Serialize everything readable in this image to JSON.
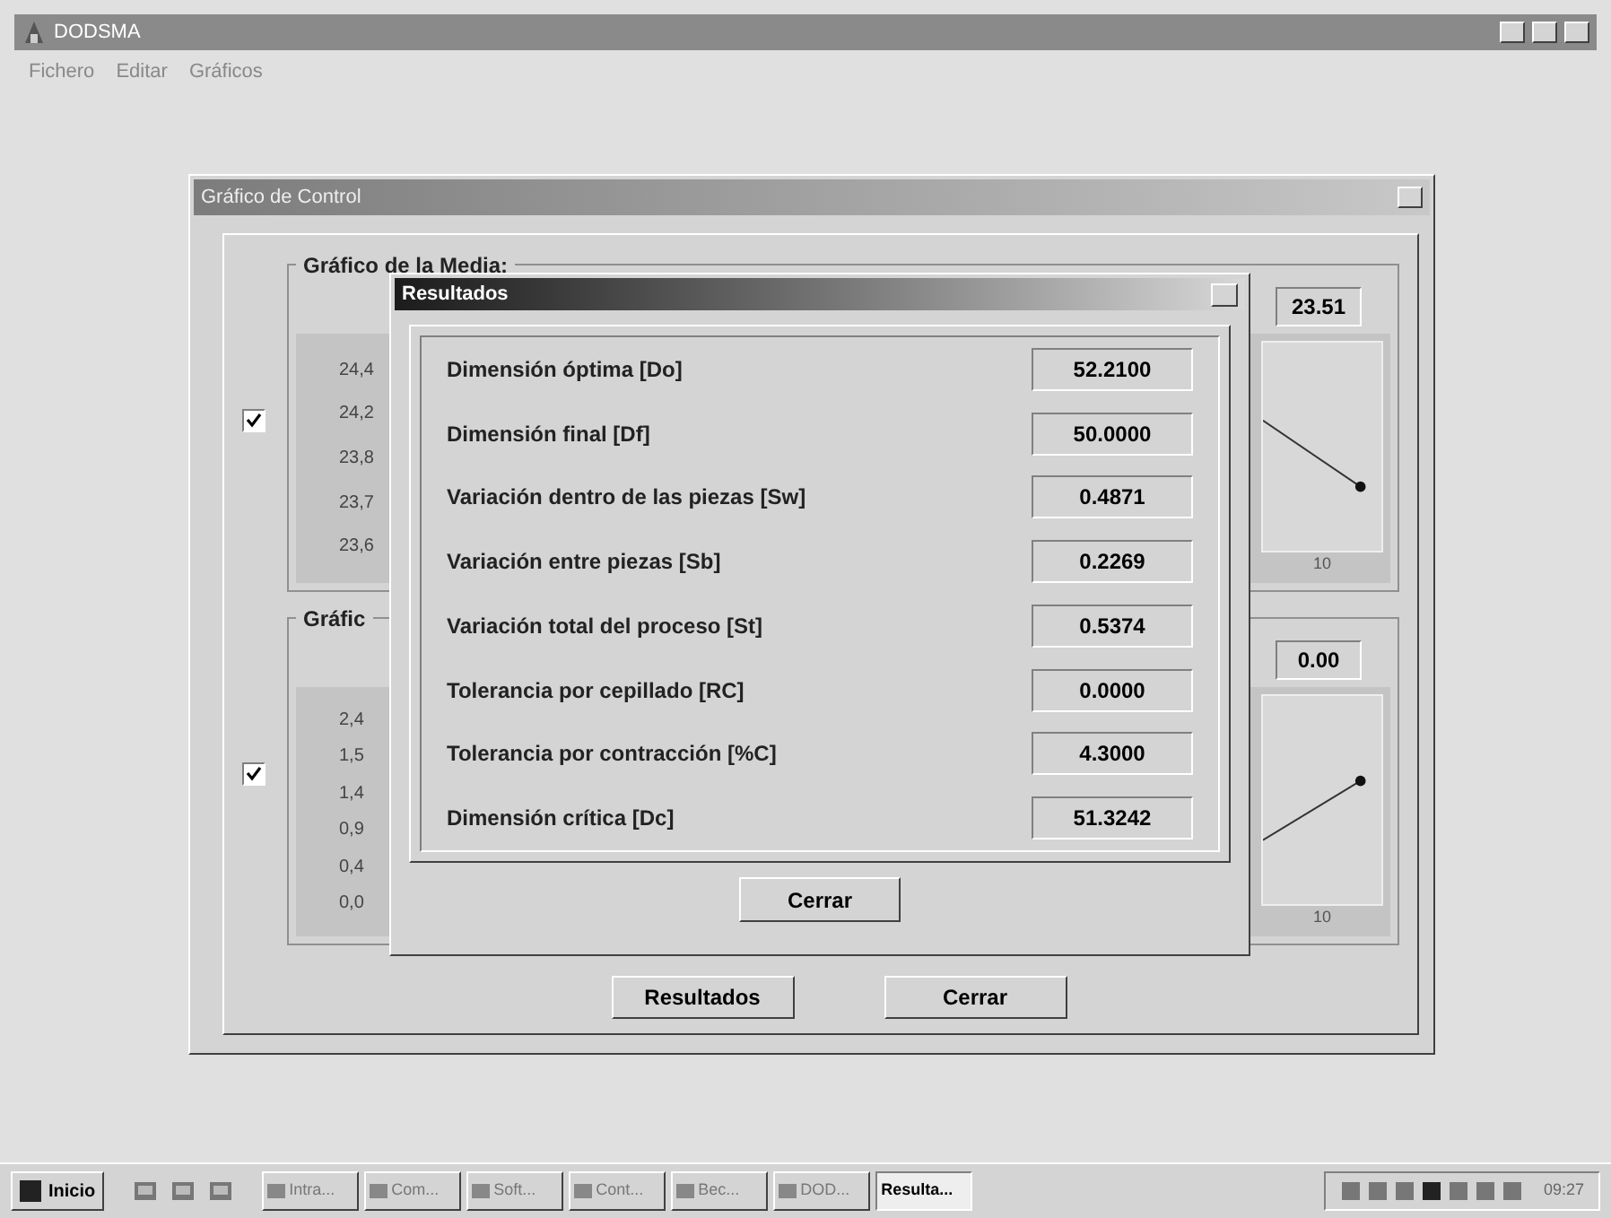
{
  "app_window": {
    "title": "DODSMA",
    "menu": [
      "Fichero",
      "Editar",
      "Gráficos"
    ]
  },
  "control_window": {
    "title": "Gráfico de Control",
    "groups": [
      {
        "title": "Gráfico de la Media:",
        "checked": true,
        "value": "23.51",
        "y_labels": [
          "24,4",
          "24,2",
          "23,8",
          "23,7",
          "23,6"
        ],
        "x_label": "10"
      },
      {
        "title": "Gráfic",
        "checked": true,
        "value": "0.00",
        "y_labels": [
          "2,4",
          "1,5",
          "1,4",
          "0,9",
          "0,4",
          "0,0"
        ],
        "x_label": "10"
      }
    ],
    "buttons": [
      "Resultados",
      "Cerrar"
    ]
  },
  "results_dialog": {
    "title": "Resultados",
    "rows": [
      {
        "label": "Dimensión óptima [Do]",
        "value": "52.2100"
      },
      {
        "label": "Dimensión final [Df]",
        "value": "50.0000"
      },
      {
        "label": "Variación dentro de las piezas [Sw]",
        "value": "0.4871"
      },
      {
        "label": "Variación entre piezas [Sb]",
        "value": "0.2269"
      },
      {
        "label": "Variación total del proceso [St]",
        "value": "0.5374"
      },
      {
        "label": "Tolerancia por cepillado [RC]",
        "value": "0.0000"
      },
      {
        "label": "Tolerancia por contracción [%C]",
        "value": "4.3000"
      },
      {
        "label": "Dimensión crítica [Dc]",
        "value": "51.3242"
      }
    ],
    "button": "Cerrar"
  },
  "taskbar": {
    "start": "Inicio",
    "tasks": [
      {
        "label": "Intra...",
        "selected": false
      },
      {
        "label": "Com...",
        "selected": false
      },
      {
        "label": "Soft...",
        "selected": false
      },
      {
        "label": "Cont...",
        "selected": false
      },
      {
        "label": "Bec...",
        "selected": false
      },
      {
        "label": "DOD...",
        "selected": false
      },
      {
        "label": "Resulta...",
        "selected": true
      }
    ],
    "clock": "09:27"
  }
}
